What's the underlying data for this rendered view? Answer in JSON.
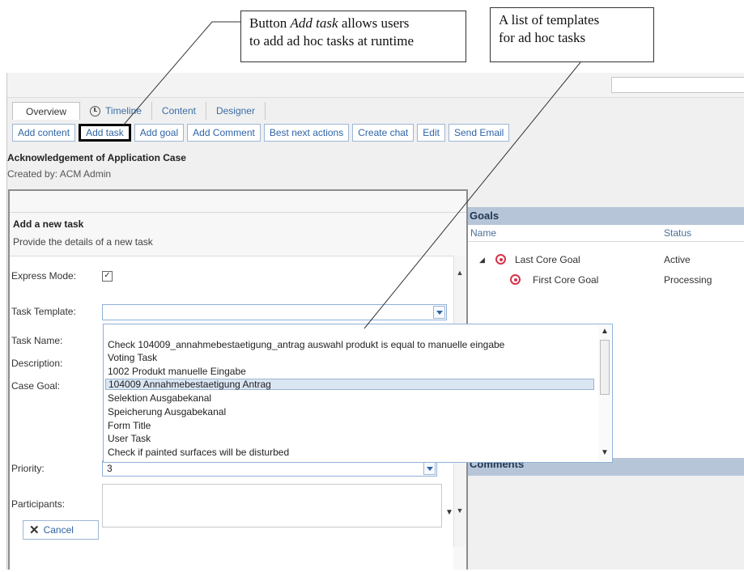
{
  "callouts": {
    "add_task_pre": "Button ",
    "add_task_em": "Add task",
    "add_task_post": " allows users",
    "add_task_line2": "to add ad hoc tasks at runtime",
    "templates_line1": "A list of templates",
    "templates_line2": "for ad hoc tasks"
  },
  "tabs": {
    "overview": "Overview",
    "timeline": "Timeline",
    "content": "Content",
    "designer": "Designer"
  },
  "toolbar": {
    "add_content": "Add content",
    "add_task": "Add task",
    "add_goal": "Add goal",
    "add_comment": "Add Comment",
    "best_next_actions": "Best next actions",
    "create_chat": "Create chat",
    "edit": "Edit",
    "send_email": "Send Email"
  },
  "case": {
    "title": "Acknowledgement of Application Case",
    "created_by": "Created by: ACM Admin"
  },
  "dialog": {
    "title": "Add a new task",
    "subtitle": "Provide the details of a new task",
    "express_mode_label": "Express Mode:",
    "express_mode_checked": true,
    "task_template_label": "Task Template:",
    "task_template_value": "",
    "task_name_label": "Task Name:",
    "description_label": "Description:",
    "case_goal_label": "Case Goal:",
    "priority_label": "Priority:",
    "priority_value": "3",
    "participants_label": "Participants:",
    "cancel_label": "Cancel"
  },
  "template_options": [
    "Check 104009_annahmebestaetigung_antrag auswahl produkt is equal to manuelle eingabe",
    "Voting Task",
    "1002 Produkt manuelle Eingabe",
    "104009 Annahmebestaetigung Antrag",
    "Selektion Ausgabekanal",
    "Speicherung Ausgabekanal",
    "Form Title",
    "User Task",
    "Check if painted surfaces will be disturbed"
  ],
  "selected_template": "104009 Annahmebestaetigung Antrag",
  "goals": {
    "header": "Goals",
    "col_name": "Name",
    "col_status": "Status",
    "rows": [
      {
        "name": "Last Core Goal",
        "status": "Active"
      },
      {
        "name": "First Core Goal",
        "status": "Processing"
      }
    ]
  },
  "comments": {
    "header": "Comments"
  },
  "icons": {
    "timeline": "clock-icon",
    "goal": "target-icon",
    "cancel": "x-icon",
    "expand": "collapse-triangle-icon"
  },
  "colors": {
    "accent": "#2f64a6",
    "panel_header": "#b6c6d8",
    "goal_icon": "#d8334a"
  }
}
